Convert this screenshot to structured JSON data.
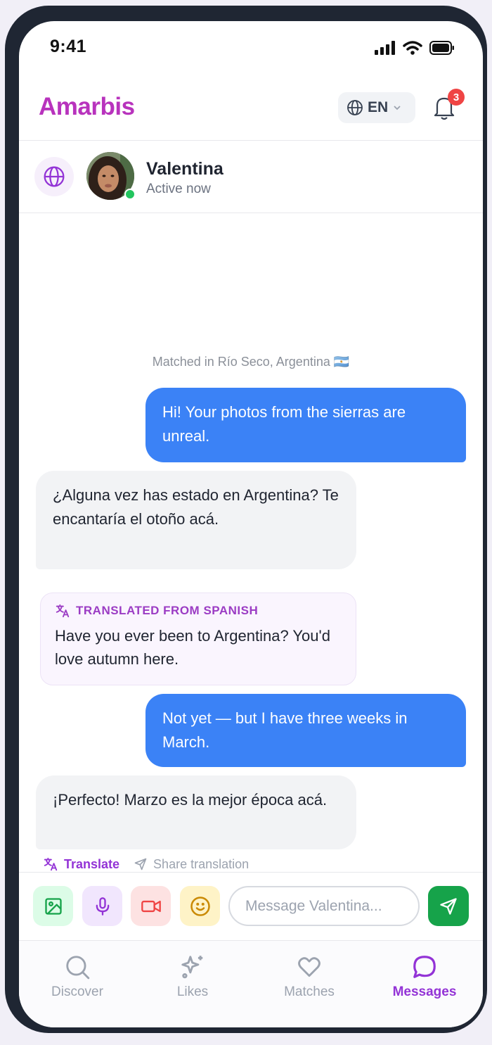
{
  "status_bar": {
    "time": "9:41"
  },
  "app": {
    "brand": "Amarbis",
    "language": "EN",
    "notifications_count": "3"
  },
  "chat_header": {
    "contact_name": "Valentina",
    "contact_status": "Active now"
  },
  "chat": {
    "matched_note": "Matched in Río Seco, Argentina 🇦🇷",
    "messages": [
      {
        "from": "me",
        "text": "Hi! Your photos from the sierras are unreal."
      },
      {
        "from": "them",
        "text": "¿Alguna vez has estado en Argentina? Te encantaría el otoño acá."
      },
      {
        "from": "me",
        "text": "Not yet — but I have three weeks in March."
      },
      {
        "from": "them",
        "text": "¡Perfecto! Marzo es la mejor época acá."
      }
    ],
    "translation": {
      "label": "TRANSLATED FROM SPANISH",
      "text": "Have you ever been to Argentina? You'd love autumn here."
    },
    "actions": {
      "translate": "Translate",
      "share": "Share translation"
    }
  },
  "composer": {
    "placeholder": "Message Valentina..."
  },
  "nav": {
    "items": [
      {
        "label": "Discover"
      },
      {
        "label": "Likes"
      },
      {
        "label": "Matches"
      },
      {
        "label": "Messages",
        "active": true
      }
    ]
  },
  "colors": {
    "brand": "#b833bd",
    "outgoing_bubble": "#3b82f6",
    "incoming_bubble": "#f2f3f5",
    "send_button": "#16a34a",
    "active_nav": "#9333d6",
    "badge": "#ef4444"
  }
}
